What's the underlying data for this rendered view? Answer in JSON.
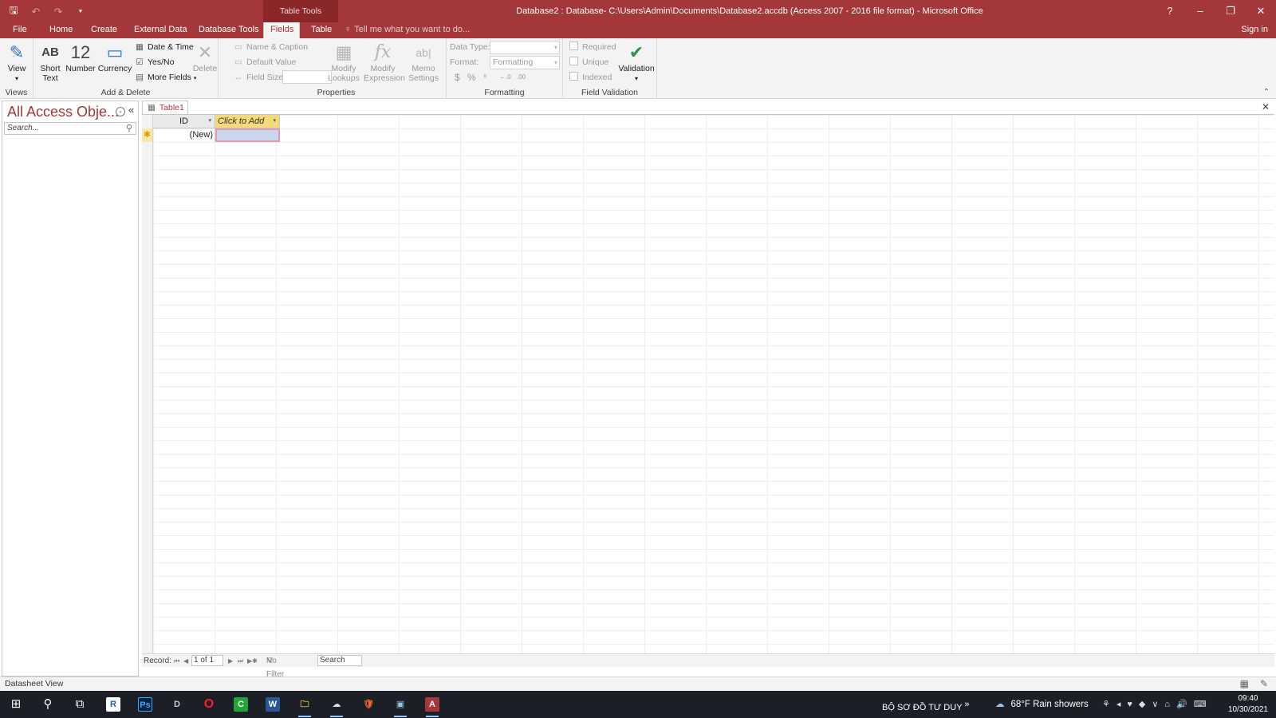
{
  "window": {
    "title": "Database2 : Database- C:\\Users\\Admin\\Documents\\Database2.accdb (Access 2007 - 2016 file format) - Microsoft Office",
    "context_group": "Table Tools",
    "controls": {
      "help": "?",
      "minimize": "–",
      "restore": "❐",
      "close": "✕"
    }
  },
  "quick_access": {
    "save": "🖫",
    "undo": "↶",
    "redo": "↷",
    "customize": "⯆"
  },
  "tabs": {
    "file": "File",
    "home": "Home",
    "create": "Create",
    "external_data": "External Data",
    "database_tools": "Database Tools",
    "fields": "Fields",
    "table": "Table",
    "tell_me": "Tell me what you want to do...",
    "sign_in": "Sign in"
  },
  "ribbon": {
    "views": {
      "label": "Views",
      "view": "View",
      "view_arrow": "▾"
    },
    "add_delete": {
      "label": "Add & Delete",
      "short_text_icon": "AB",
      "short_text_1": "Short",
      "short_text_2": "Text",
      "number_icon": "12",
      "number": "Number",
      "currency": "Currency",
      "date_time": "Date & Time",
      "yes_no": "Yes/No",
      "more_fields": "More Fields",
      "delete": "Delete"
    },
    "properties": {
      "label": "Properties",
      "name_caption": "Name & Caption",
      "default_value": "Default Value",
      "field_size": "Field Size",
      "modify_lookups_1": "Modify",
      "modify_lookups_2": "Lookups",
      "modify_expression_1": "Modify",
      "modify_expression_2": "Expression",
      "memo_settings_1": "Memo",
      "memo_settings_2": "Settings"
    },
    "formatting": {
      "label": "Formatting",
      "data_type": "Data Type:",
      "format": "Format:",
      "format_value": "Formatting",
      "currency_sym": "$",
      "percent_sym": "%",
      "comma_sym": "⁹",
      "inc_dec": "←.0",
      "dec_dec": ".00"
    },
    "field_validation": {
      "label": "Field Validation",
      "required": "Required",
      "unique": "Unique",
      "indexed": "Indexed",
      "validation": "Validation",
      "validation_arrow": "▾"
    },
    "collapse": "⌃"
  },
  "nav_pane": {
    "title": "All Access Obje...",
    "dropdown": "⌄",
    "collapse": "«",
    "search_placeholder": "Search...",
    "search_icon": "⚲"
  },
  "document": {
    "tab_label": "Table1",
    "close": "✕",
    "columns": {
      "id": "ID",
      "click_to_add": "Click to Add",
      "arrow": "▾"
    },
    "new_row": {
      "marker": "✱",
      "id_value": "(New)"
    },
    "record_nav": {
      "label": "Record:",
      "first": "⏮",
      "prev": "◀",
      "position": "1 of 1",
      "next": "▶",
      "last": "⏭",
      "new": "▶✱",
      "filter": "No Filter",
      "search": "Search"
    }
  },
  "status": {
    "text": "Datasheet View",
    "datasheet_icon": "▦",
    "design_icon": "✎"
  },
  "taskbar": {
    "start": "⊞",
    "search": "⚲",
    "task_view": "⧉",
    "apps": [
      "R",
      "Ps",
      "D",
      "O",
      "C",
      "W",
      "🗀",
      "☁",
      "🛡",
      "▣",
      "A"
    ],
    "toolbar_label": "BỘ SƠ ĐỒ TƯ DUY",
    "toolbar_more": "»",
    "weather_icon": "☁",
    "weather": "68°F  Rain showers",
    "tray": "⚘◂♥◆∨⌂🔊⌨",
    "time": "09:40",
    "date": "10/30/2021"
  }
}
